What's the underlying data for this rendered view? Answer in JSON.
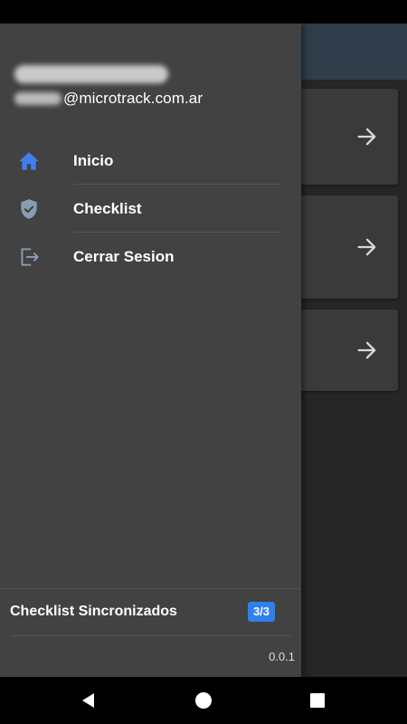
{
  "drawer": {
    "account": {
      "name": "",
      "email_domain": "@microtrack.com.ar"
    },
    "menu": [
      {
        "label": "Inicio",
        "icon": "home-icon",
        "icon_color": "#3f7ef0"
      },
      {
        "label": "Checklist",
        "icon": "shield-check-icon",
        "icon_color": "#8a9bb4"
      },
      {
        "label": "Cerrar Sesion",
        "icon": "logout-icon",
        "icon_color": "#8a9bb4"
      }
    ],
    "footer": {
      "sync_label": "Checklist Sincronizados",
      "sync_count": "3/3",
      "version": "0.0.1"
    }
  },
  "colors": {
    "accent": "#2f80ed",
    "drawer_bg": "#424242",
    "app_bar": "#2f3e4a",
    "app_bg": "#262626",
    "card_bg": "#3a3a3a"
  },
  "background_app": {
    "cards": [
      {
        "icon": "arrow-right-icon"
      },
      {
        "icon": "arrow-right-icon"
      },
      {
        "icon": "arrow-right-icon"
      }
    ]
  },
  "navigation_bar": {
    "buttons": [
      "back-icon",
      "home-circle-icon",
      "recent-apps-icon"
    ]
  }
}
